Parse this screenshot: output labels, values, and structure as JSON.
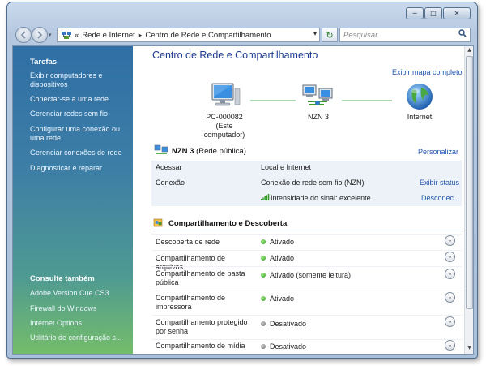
{
  "window": {
    "minimize_glyph": "─",
    "maximize_glyph": "□",
    "close_glyph": "✕"
  },
  "address_bar": {
    "breadcrumb_prefix": "«",
    "crumbs": [
      "Rede e Internet",
      "Centro de Rede e Compartilhamento"
    ],
    "separator": "▸",
    "dropdown_glyph": "▾",
    "refresh_glyph": "↻",
    "search_placeholder": "Pesquisar",
    "search_glyph": "⚲"
  },
  "sidebar": {
    "tasks_heading": "Tarefas",
    "tasks": [
      "Exibir computadores e dispositivos",
      "Conectar-se a uma rede",
      "Gerenciar redes sem fio",
      "Configurar uma conexão ou uma rede",
      "Gerenciar conexões de rede",
      "Diagnosticar e reparar"
    ],
    "see_also_heading": "Consulte também",
    "see_also": [
      "Adobe Version Cue CS3",
      "Firewall do Windows",
      "Internet Options",
      "Utilitário de configuração s..."
    ]
  },
  "main": {
    "title": "Centro de Rede e Compartilhamento",
    "map_link": "Exibir mapa completo",
    "nodes": {
      "computer_name": "PC-000082",
      "computer_sub": "(Este computador)",
      "network_name": "NZN  3",
      "internet_name": "Internet"
    },
    "network": {
      "name": "NZN  3",
      "type": "(Rede pública)",
      "customize_link": "Personalizar",
      "access_label": "Acessar",
      "access_value": "Local e Internet",
      "connection_label": "Conexão",
      "connection_value": "Conexão de rede sem fio (NZN)",
      "view_status_link": "Exibir status",
      "signal_value": "Intensidade do sinal: excelente",
      "disconnect_link": "Desconec..."
    },
    "sharing": {
      "heading": "Compartilhamento e Descoberta",
      "expander_glyph": "⌄",
      "rows": [
        {
          "label": "Descoberta de rede",
          "status": "Ativado",
          "state": "on"
        },
        {
          "label": "Compartilhamento de arquivos",
          "status": "Ativado",
          "state": "on"
        },
        {
          "label": "Compartilhamento de pasta pública",
          "status": "Ativado (somente leitura)",
          "state": "on"
        },
        {
          "label": "Compartilhamento de impressora",
          "status": "Ativado",
          "state": "on"
        },
        {
          "label": "Compartilhamento protegido por senha",
          "status": "Desativado",
          "state": "off"
        },
        {
          "label": "Compartilhamento de mídia",
          "status": "Desativado",
          "state": "off"
        }
      ]
    }
  },
  "colors": {
    "link": "#1f54ad",
    "title": "#1a3a8f",
    "sidebar_top": "#2f6fa5",
    "sidebar_bottom": "#74bd6a",
    "status_on": "#2f9a22",
    "status_off": "#6b6b6b"
  }
}
